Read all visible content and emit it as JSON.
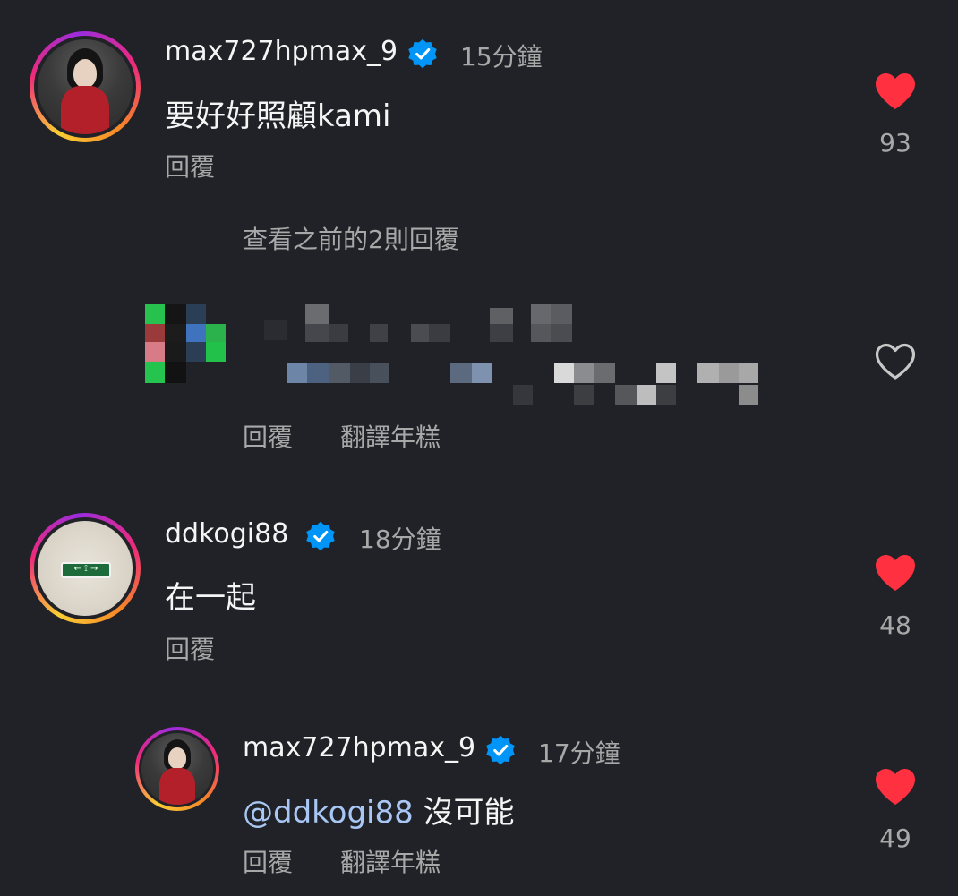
{
  "comments": [
    {
      "username": "max727hpmax_9",
      "time": "15分鐘",
      "text": "要好好照顧kami",
      "actions": [
        "回覆"
      ],
      "likes": "93",
      "liked": true
    },
    {
      "view_previous": "查看之前的2則回覆",
      "actions": [
        "回覆",
        "翻譯年糕"
      ],
      "liked": false
    },
    {
      "username": "ddkogi88",
      "time": "18分鐘",
      "text": "在一起",
      "actions": [
        "回覆"
      ],
      "likes": "48",
      "liked": true
    },
    {
      "username": "max727hpmax_9",
      "time": "17分鐘",
      "mention": "@ddkogi88",
      "text": "沒可能",
      "actions": [
        "回覆",
        "翻譯年糕"
      ],
      "likes": "49",
      "liked": true
    }
  ],
  "colors": {
    "background": "#202227",
    "heart_liked": "#ff3040",
    "verified": "#0095f6",
    "mention": "#a9c7f4"
  },
  "icons": {
    "verified": "verified-badge-icon",
    "liked": "heart-filled-icon",
    "unliked": "heart-outline-icon"
  }
}
